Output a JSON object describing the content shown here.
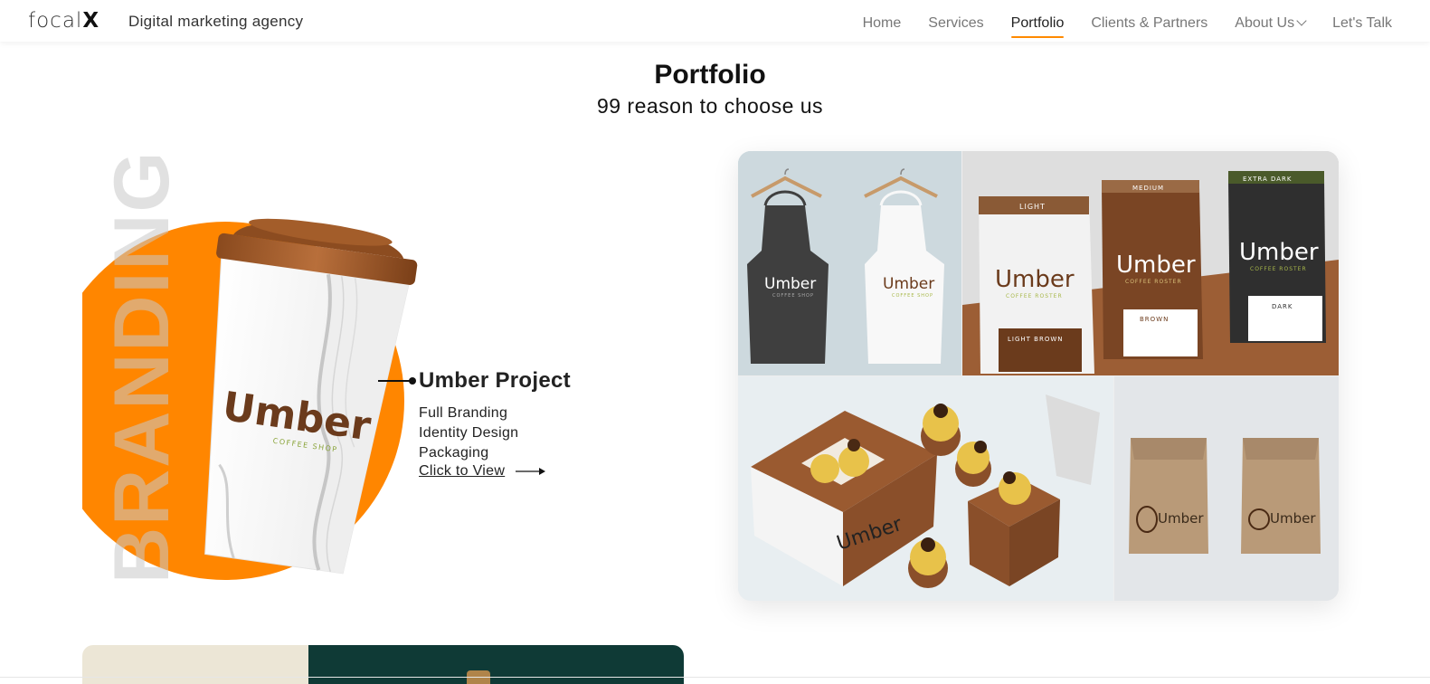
{
  "header": {
    "logo_text": "focal",
    "logo_mark": "X",
    "tagline": "Digital marketing agency",
    "nav": [
      {
        "label": "Home",
        "active": false
      },
      {
        "label": "Services",
        "active": false
      },
      {
        "label": "Portfolio",
        "active": true
      },
      {
        "label": "Clients & Partners",
        "active": false
      },
      {
        "label": "About Us",
        "active": false,
        "dropdown": true
      },
      {
        "label": "Let's Talk",
        "active": false
      }
    ]
  },
  "page": {
    "title": "Portfolio",
    "subtitle": "99 reason to choose us"
  },
  "project": {
    "category": "BRANDING",
    "name": "Umber Project",
    "services": [
      "Full Branding",
      "Identity Design",
      "Packaging"
    ],
    "view_label": "Click to View",
    "cup_brand": "Umber",
    "cup_sub": "COFFEE SHOP"
  },
  "gallery": {
    "apron_brand": "Umber",
    "apron_sub": "COFFEE SHOP",
    "bags": [
      {
        "label": "LIGHT",
        "brand": "Umber",
        "sub": "COFFEE ROSTER",
        "roast": "LIGHT BROWN"
      },
      {
        "label": "MEDIUM",
        "brand": "Umber",
        "sub": "COFFEE ROSTER",
        "roast": "BROWN"
      },
      {
        "label": "EXTRA DARK",
        "brand": "Umber",
        "sub": "COFFEE ROSTER",
        "roast": "DARK"
      }
    ],
    "box_brand": "Umber",
    "paper_brand": "Umber"
  },
  "colors": {
    "accent": "#ff8600",
    "umber_brown": "#6b3b1c",
    "text": "#111111"
  }
}
